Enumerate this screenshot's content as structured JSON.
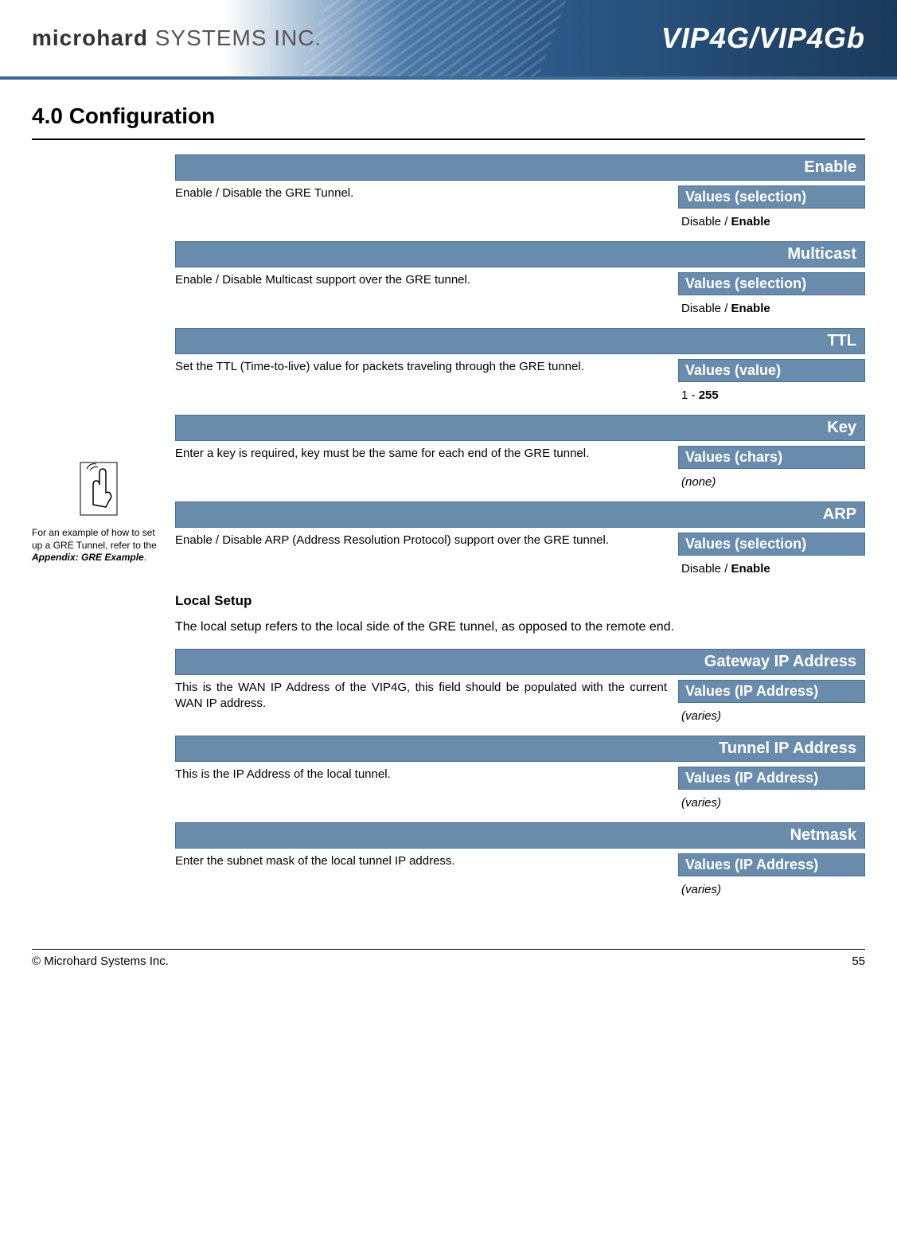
{
  "header": {
    "logo_left_a": "microhard",
    "logo_left_b": " SYSTEMS INC.",
    "logo_right": "VIP4G/VIP4Gb"
  },
  "section_title": "4.0  Configuration",
  "sidebar": {
    "note_1": "For an example of how to set up a GRE Tunnel, refer to the ",
    "note_em": "Appendix: GRE Example",
    "note_2": "."
  },
  "params": [
    {
      "title": "Enable",
      "desc": "Enable / Disable the GRE Tunnel.",
      "values_label": "Values (selection)",
      "values_content": "Disable / ",
      "values_bold": "Enable"
    },
    {
      "title": "Multicast",
      "desc": "Enable / Disable Multicast support over the GRE tunnel.",
      "values_label": "Values (selection)",
      "values_content": "Disable / ",
      "values_bold": "Enable"
    },
    {
      "title": "TTL",
      "desc": "Set the TTL (Time-to-live) value for packets traveling through the GRE tunnel.",
      "values_label": "Values (value)",
      "values_content": "1 - ",
      "values_bold": "255"
    },
    {
      "title": "Key",
      "desc": "Enter a key is required, key must be the same for each end of the GRE tunnel.",
      "values_label": "Values (chars)",
      "values_italic": "(none)"
    },
    {
      "title": "ARP",
      "desc": "Enable / Disable ARP (Address Resolution Protocol) support over the GRE tunnel.",
      "values_label": "Values (selection)",
      "values_content": "Disable / ",
      "values_bold": "Enable"
    }
  ],
  "subsection": {
    "title": "Local Setup",
    "text": "The local setup refers to the local side of the GRE tunnel, as opposed to the remote end."
  },
  "params2": [
    {
      "title": "Gateway IP Address",
      "desc": "This is the WAN IP Address of the VIP4G, this field should be populated with the current WAN IP address.",
      "values_label": "Values (IP Address)",
      "values_italic": "(varies)"
    },
    {
      "title": "Tunnel IP Address",
      "desc": "This is the IP Address of the local tunnel.",
      "values_label": "Values (IP Address)",
      "values_italic": "(varies)"
    },
    {
      "title": "Netmask",
      "desc": "Enter the subnet mask of the local tunnel IP address.",
      "values_label": "Values (IP Address)",
      "values_italic": "(varies)"
    }
  ],
  "footer": {
    "copyright": "© Microhard Systems Inc.",
    "page": "55"
  }
}
